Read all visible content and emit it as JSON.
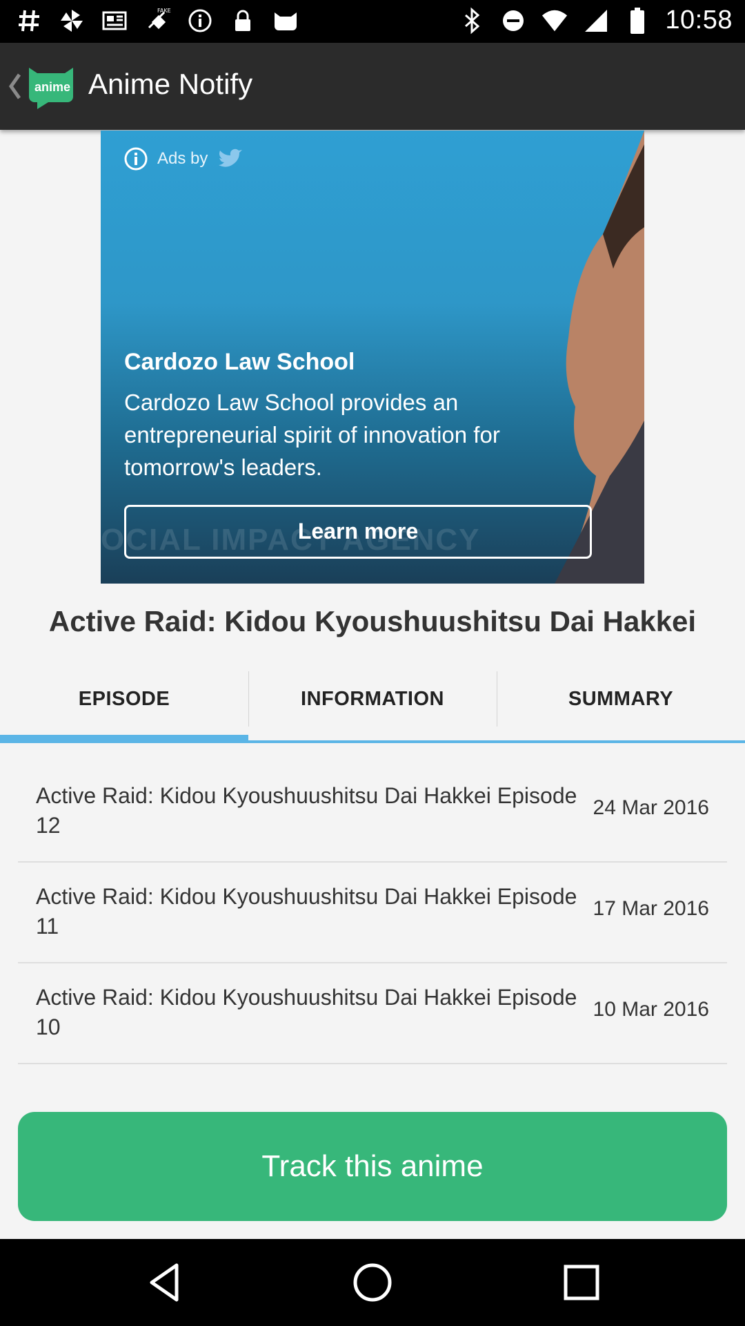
{
  "status_bar": {
    "time": "10:58",
    "left_icons": [
      "hashtag-icon",
      "pinwheel-icon",
      "newspaper-icon",
      "fake-gps-icon",
      "info-icon",
      "lock-icon",
      "cat-icon"
    ],
    "right_icons": [
      "bluetooth-icon",
      "do-not-disturb-icon",
      "wifi-icon",
      "signal-icon",
      "battery-icon"
    ]
  },
  "app_bar": {
    "logo_text": "anime",
    "title": "Anime Notify"
  },
  "ad": {
    "ads_by_label": "Ads by",
    "watermark": "OCIAL IMPACT AGENCY",
    "headline": "Cardozo Law School",
    "body": "Cardozo Law School provides an entrepreneurial spirit of innovation for tomorrow's leaders.",
    "cta": "Learn more"
  },
  "anime_title": "Active Raid: Kidou Kyoushuushitsu Dai Hakkei",
  "tabs": [
    {
      "label": "EPISODE",
      "active": true
    },
    {
      "label": "INFORMATION",
      "active": false
    },
    {
      "label": "SUMMARY",
      "active": false
    }
  ],
  "episodes": [
    {
      "title": "Active Raid: Kidou Kyoushuushitsu Dai Hakkei Episode 12",
      "date": "24 Mar 2016"
    },
    {
      "title": "Active Raid: Kidou Kyoushuushitsu Dai Hakkei Episode 11",
      "date": "17 Mar 2016"
    },
    {
      "title": "Active Raid: Kidou Kyoushuushitsu Dai Hakkei Episode 10",
      "date": "10 Mar 2016"
    }
  ],
  "track_button": "Track this anime",
  "colors": {
    "accent_green": "#37b77a",
    "tab_underline": "#5bb5e6",
    "app_bar": "#2b2b2b"
  }
}
